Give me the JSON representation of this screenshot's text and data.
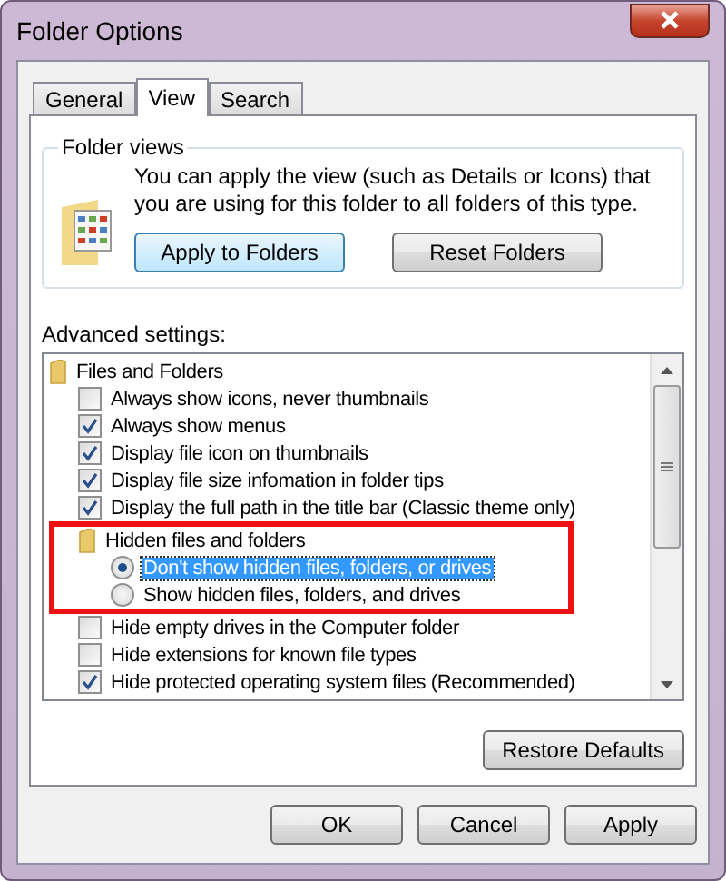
{
  "window": {
    "title": "Folder Options"
  },
  "tabs": [
    {
      "label": "General",
      "selected": false
    },
    {
      "label": "View",
      "selected": true
    },
    {
      "label": "Search",
      "selected": false
    }
  ],
  "folder_views": {
    "title": "Folder views",
    "text": "You can apply the view (such as Details or Icons) that you are using for this folder to all folders of this type.",
    "buttons": [
      {
        "label": "Apply to Folders",
        "default": true
      },
      {
        "label": "Reset Folders",
        "default": false
      }
    ]
  },
  "advanced": {
    "label": "Advanced settings:",
    "tree": [
      {
        "kind": "folder",
        "label": "Files and Folders",
        "highlighted": false,
        "children": [
          {
            "kind": "checkbox",
            "label": "Always show icons, never thumbnails",
            "checked": false
          },
          {
            "kind": "checkbox",
            "label": "Always show menus",
            "checked": true
          },
          {
            "kind": "checkbox",
            "label": "Display file icon on thumbnails",
            "checked": true
          },
          {
            "kind": "checkbox",
            "label": "Display file size infomation in folder tips",
            "checked": true
          },
          {
            "kind": "checkbox",
            "label": "Display the full path in the title bar (Classic theme only)",
            "checked": true
          },
          {
            "kind": "folder",
            "label": "Hidden files and folders",
            "highlighted": true,
            "children": [
              {
                "kind": "radio",
                "label": "Don't show hidden files, folders, or drives",
                "selected": true
              },
              {
                "kind": "radio",
                "label": "Show hidden files, folders, and drives",
                "selected": false
              }
            ]
          },
          {
            "kind": "checkbox",
            "label": "Hide empty drives in the Computer folder",
            "checked": false
          },
          {
            "kind": "checkbox",
            "label": "Hide extensions for known file types",
            "checked": false
          },
          {
            "kind": "checkbox",
            "label": "Hide protected operating system files (Recommended)",
            "checked": true
          }
        ]
      }
    ]
  },
  "restore_button": "Restore Defaults",
  "dialog_buttons": [
    "OK",
    "Cancel",
    "Apply"
  ]
}
